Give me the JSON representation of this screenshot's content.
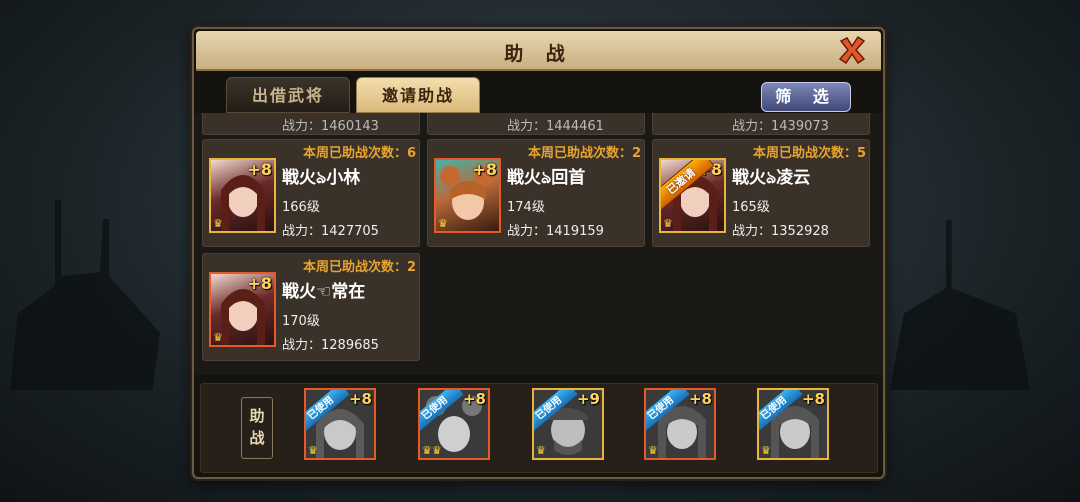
{
  "dialog": {
    "title": "助 战",
    "close_icon": "close-x-icon"
  },
  "tabs": [
    {
      "label": "出借武将",
      "active": false
    },
    {
      "label": "邀请助战",
      "active": true
    }
  ],
  "filter_button": {
    "label": "筛 选"
  },
  "partial_top_row": [
    {
      "power": "战力：1460143"
    },
    {
      "power": "战力：1444461"
    },
    {
      "power": "战力：1439073"
    }
  ],
  "cards": [
    {
      "weekly": "本周已助战次数：6",
      "name": "戦火ঌ小林",
      "level": "166级",
      "power": "战力：1427705",
      "plus": "+8",
      "frame": "gold",
      "invited": false
    },
    {
      "weekly": "本周已助战次数：2",
      "name": "戦火ঌ回首",
      "level": "174级",
      "power": "战力：1419159",
      "plus": "+8",
      "frame": "orange",
      "invited": false
    },
    {
      "weekly": "本周已助战次数：5",
      "name": "戦火ঌ凌云",
      "level": "165级",
      "power": "战力：1352928",
      "plus": "+8",
      "frame": "gold",
      "invited": true,
      "invited_label": "已邀请"
    },
    {
      "weekly": "本周已助战次数：2",
      "name": "戦火☜常在",
      "level": "170级",
      "power": "战力：1289685",
      "plus": "+8",
      "frame": "orange",
      "invited": false
    }
  ],
  "assist_bar": {
    "label_top": "助",
    "label_bottom": "战",
    "slots": [
      {
        "badge": "已使用",
        "plus": "+8",
        "frame": "orange",
        "crowns": "♛"
      },
      {
        "badge": "已使用",
        "plus": "+8",
        "frame": "orange",
        "crowns": "♛♛"
      },
      {
        "badge": "已使用",
        "plus": "+9",
        "frame": "gold",
        "crowns": "♛"
      },
      {
        "badge": "已使用",
        "plus": "+8",
        "frame": "orange",
        "crowns": "♛"
      },
      {
        "badge": "已使用",
        "plus": "+8",
        "frame": "gold",
        "crowns": "♛"
      }
    ]
  },
  "colors": {
    "accent_gold": "#e8b63a",
    "accent_orange": "#e55a2a",
    "weekly_text": "#e8a42e"
  }
}
